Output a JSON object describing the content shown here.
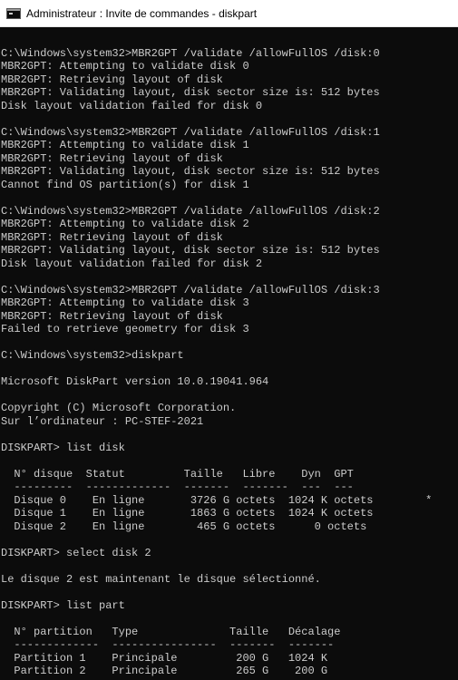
{
  "window": {
    "title": "Administrateur : Invite de commandes - diskpart",
    "icon": "cmd-icon"
  },
  "colors": {
    "background": "#0c0c0c",
    "text": "#cccccc",
    "titlebar": "#ffffff"
  },
  "console": {
    "lines": [
      "",
      "C:\\Windows\\system32>MBR2GPT /validate /allowFullOS /disk:0",
      "MBR2GPT: Attempting to validate disk 0",
      "MBR2GPT: Retrieving layout of disk",
      "MBR2GPT: Validating layout, disk sector size is: 512 bytes",
      "Disk layout validation failed for disk 0",
      "",
      "C:\\Windows\\system32>MBR2GPT /validate /allowFullOS /disk:1",
      "MBR2GPT: Attempting to validate disk 1",
      "MBR2GPT: Retrieving layout of disk",
      "MBR2GPT: Validating layout, disk sector size is: 512 bytes",
      "Cannot find OS partition(s) for disk 1",
      "",
      "C:\\Windows\\system32>MBR2GPT /validate /allowFullOS /disk:2",
      "MBR2GPT: Attempting to validate disk 2",
      "MBR2GPT: Retrieving layout of disk",
      "MBR2GPT: Validating layout, disk sector size is: 512 bytes",
      "Disk layout validation failed for disk 2",
      "",
      "C:\\Windows\\system32>MBR2GPT /validate /allowFullOS /disk:3",
      "MBR2GPT: Attempting to validate disk 3",
      "MBR2GPT: Retrieving layout of disk",
      "Failed to retrieve geometry for disk 3",
      "",
      "C:\\Windows\\system32>diskpart",
      "",
      "Microsoft DiskPart version 10.0.19041.964",
      "",
      "Copyright (C) Microsoft Corporation.",
      "Sur l’ordinateur : PC-STEF-2021",
      "",
      "DISKPART> list disk",
      "",
      "  N° disque  Statut         Taille   Libre    Dyn  GPT",
      "  ---------  -------------  -------  -------  ---  ---",
      "  Disque 0    En ligne       3726 G octets  1024 K octets        *",
      "  Disque 1    En ligne       1863 G octets  1024 K octets",
      "  Disque 2    En ligne        465 G octets      0 octets",
      "",
      "DISKPART> select disk 2",
      "",
      "Le disque 2 est maintenant le disque sélectionné.",
      "",
      "DISKPART> list part",
      "",
      "  N° partition   Type              Taille   Décalage",
      "  -------------  ----------------  -------  -------",
      "  Partition 1    Principale         200 G   1024 K",
      "  Partition 2    Principale         265 G    200 G"
    ]
  }
}
